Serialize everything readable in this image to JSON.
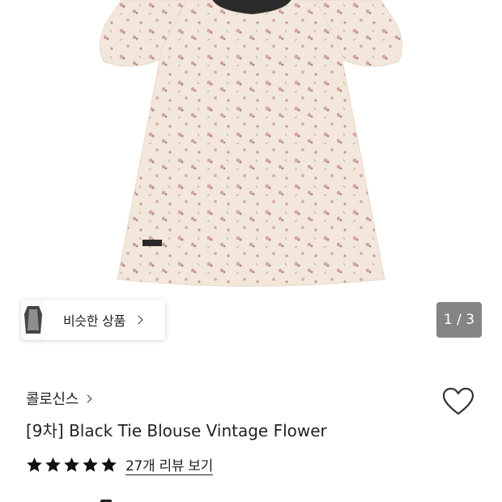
{
  "product_image": {
    "alt": "floral-blouse-photo",
    "colors": {
      "fabric": "#f2e6da",
      "flower": "#c99ca0",
      "collar": "#2a2a2a"
    }
  },
  "similar": {
    "label": "비슷한 상품",
    "icon": "chevron-right-icon"
  },
  "pager": {
    "text": "1 / 3",
    "current": 1,
    "total": 3
  },
  "brand": {
    "name": "콜로신스",
    "icon": "chevron-right-icon"
  },
  "wishlist": {
    "icon": "heart-outline-icon"
  },
  "product": {
    "title": "[9차] Black Tie Blouse Vintage Flower"
  },
  "rating": {
    "stars": 5,
    "max": 5,
    "review_link": "27개 리뷰 보기"
  }
}
